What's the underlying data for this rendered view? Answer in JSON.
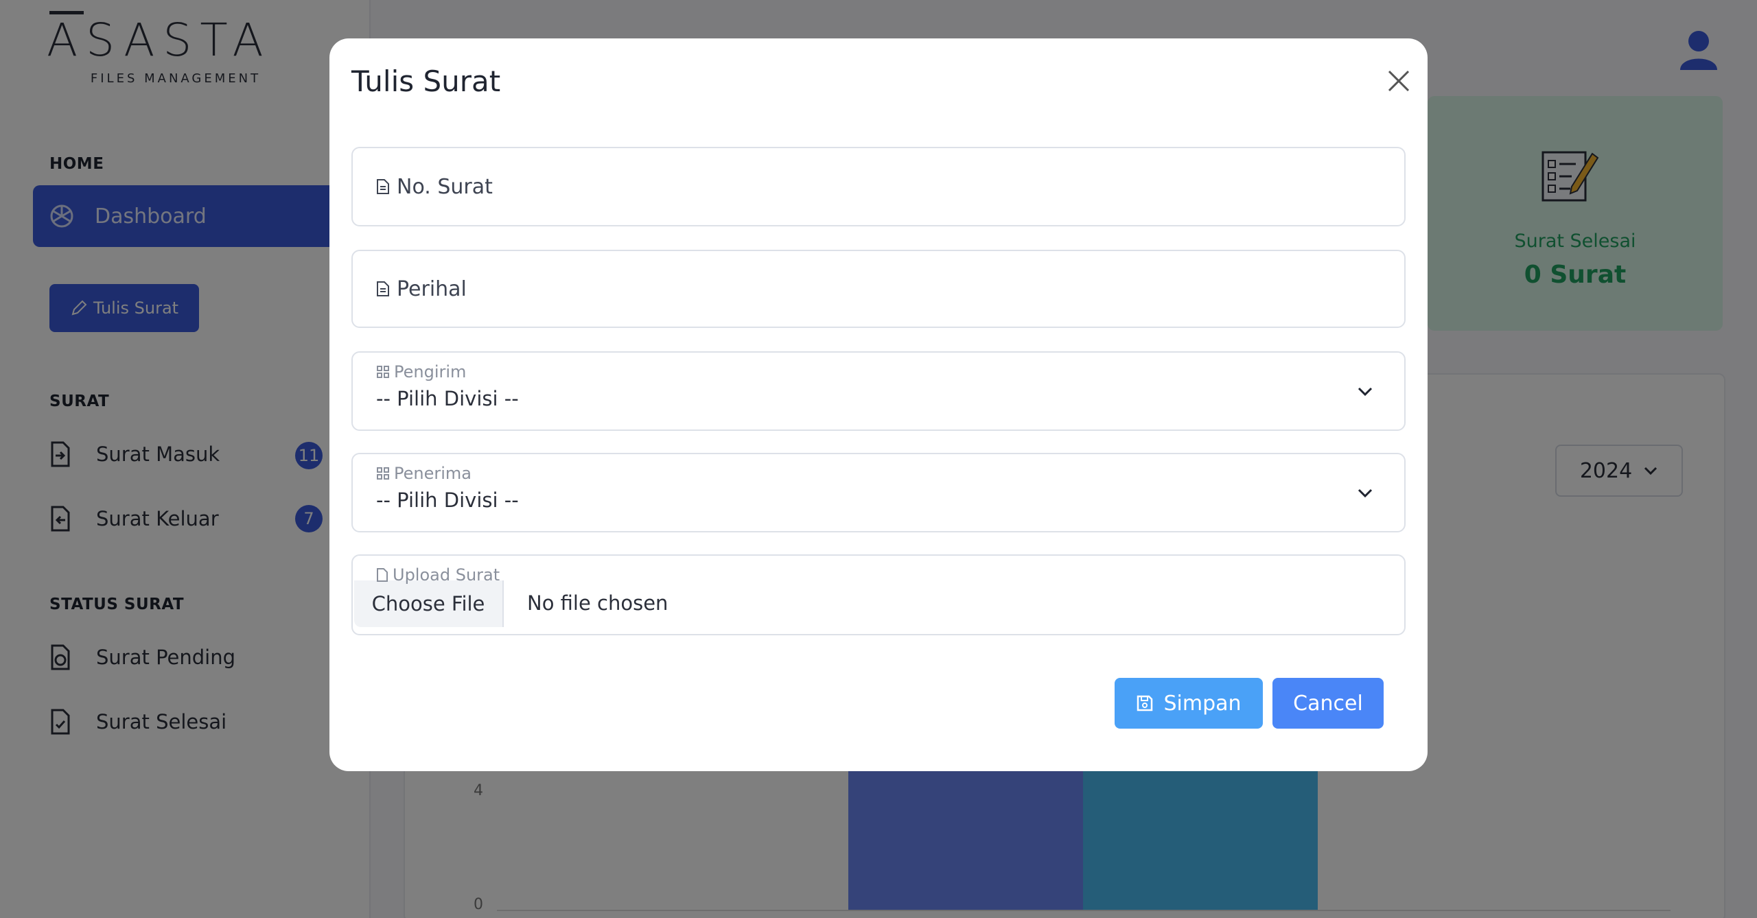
{
  "brand": {
    "name": "ASASTA",
    "tagline": "FILES MANAGEMENT"
  },
  "sidebar": {
    "home_heading": "HOME",
    "dashboard_label": "Dashboard",
    "write_button": "Tulis Surat",
    "surat_heading": "SURAT",
    "surat_items": [
      {
        "label": "Surat Masuk",
        "count": "11"
      },
      {
        "label": "Surat Keluar",
        "count": "7"
      }
    ],
    "status_heading": "STATUS SURAT",
    "status_items": [
      {
        "label": "Surat Pending"
      },
      {
        "label": "Surat Selesai"
      }
    ]
  },
  "stat_card": {
    "title": "Surat Selesai",
    "value": "0 Surat"
  },
  "chart": {
    "year": "2024",
    "y_ticks": [
      "4",
      "0"
    ]
  },
  "chart_data": {
    "type": "bar",
    "categories": [
      "",
      ""
    ],
    "series": [
      {
        "values": [
          6,
          6
        ]
      }
    ],
    "colors": [
      "#6b86f2",
      "#4bbbf0"
    ],
    "ylim": [
      0,
      8
    ]
  },
  "modal": {
    "title": "Tulis Surat",
    "no_surat_placeholder": "No. Surat",
    "perihal_placeholder": "Perihal",
    "pengirim_label": "Pengirim",
    "pengirim_value": "-- Pilih Divisi --",
    "penerima_label": "Penerima",
    "penerima_value": "-- Pilih Divisi --",
    "upload_label": "Upload Surat",
    "choose_file": "Choose File",
    "no_file": "No file chosen",
    "save_label": "Simpan",
    "cancel_label": "Cancel"
  },
  "colors": {
    "primary": "#3b5bdb",
    "save": "#4aa1f7",
    "cancel": "#4a86f7",
    "stat_bg": "#d9f4e7",
    "stat_text": "#20a060"
  }
}
